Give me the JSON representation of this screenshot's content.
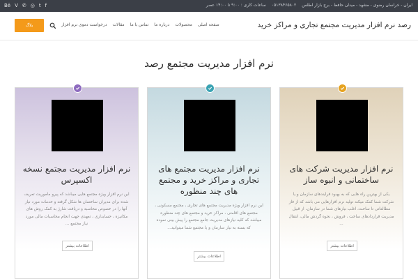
{
  "topbar": {
    "social_icons": [
      "Bē",
      "V",
      "✆",
      "◎",
      "t",
      "f"
    ],
    "location": "ایران - خراسان رضوی - مشهد - میدان حافظ - برج بازار اطلس",
    "phone": "۰۵۱۳۸۴۶۵۸۰۲",
    "hours": "ساعات کاری : ۹:۰۰ تا ۱۴:۰۰ عصر"
  },
  "header": {
    "site_title": "رصد نرم افزار مدیریت مجتمع تجاری و مراکز خرید",
    "blog_button": "بلاگ",
    "nav": [
      "صفحه اصلی",
      "محصولات",
      "درباره ما",
      "تماس با ما",
      "مقالات",
      "درخواست دموی نرم افزار"
    ]
  },
  "section": {
    "title": "نرم افزار مدیریت مجتمع رصد"
  },
  "cards": [
    {
      "title": "نرم افزار مدیریت مجتمع نسخه اکسپرس",
      "description": "این نرم افزار ویژه مجتمع هایی میباشد که پیرو ماموریت تعریف شده برای مدیران ساختمان ها شکل گرفته و خدمات مورد نیاز آنها را در خصوص محاسبه و دریافت شارژ به کمک روش های مکانیزه ، حسابداری ، تعهدی جهت انجام محاسبات مالی مورد نیاز مجتمع ...",
      "button": "اطلاعات بیشتر",
      "color": "#8e6bbf"
    },
    {
      "title": "نرم افزار مدیریت مجتمع های تجاری و مراکز خرید و مجتمع های چند منظوره",
      "description": "این نرم افزار ویژه مدیریت مجتمع های تجاری ، مجتمع مسکونی ، مجتمع های اقامتی ، مراکز خرید و مجتمع های چند منظوره میباشد که کلیه نیازهای مدیریت جامع مجتمع را پیش بینی نموده که بسته به نیاز سازمان و یا مجتمع شما میتوانید...",
      "button": "اطلاعات بیشتر",
      "color": "#3aa3b3"
    },
    {
      "title": "نرم افزار مدیریت شرکت های ساختمانی و انبوه ساز",
      "description": "یکی از بهترین راه هایی که به بهبود فرایندهای سازمان و یا شرکت شما کمک میکند تولید نرم افزارهایی می باشد که از فاز مطالعاتی تا ساخت، اغلب نیازهای شما در سازمان، از قبیل مدیریت قراردادهای ساخت ، فروش ، نحوه گردش مالی، انتقال ...",
      "button": "اطلاعات بیشتر",
      "color": "#e6a321"
    }
  ]
}
